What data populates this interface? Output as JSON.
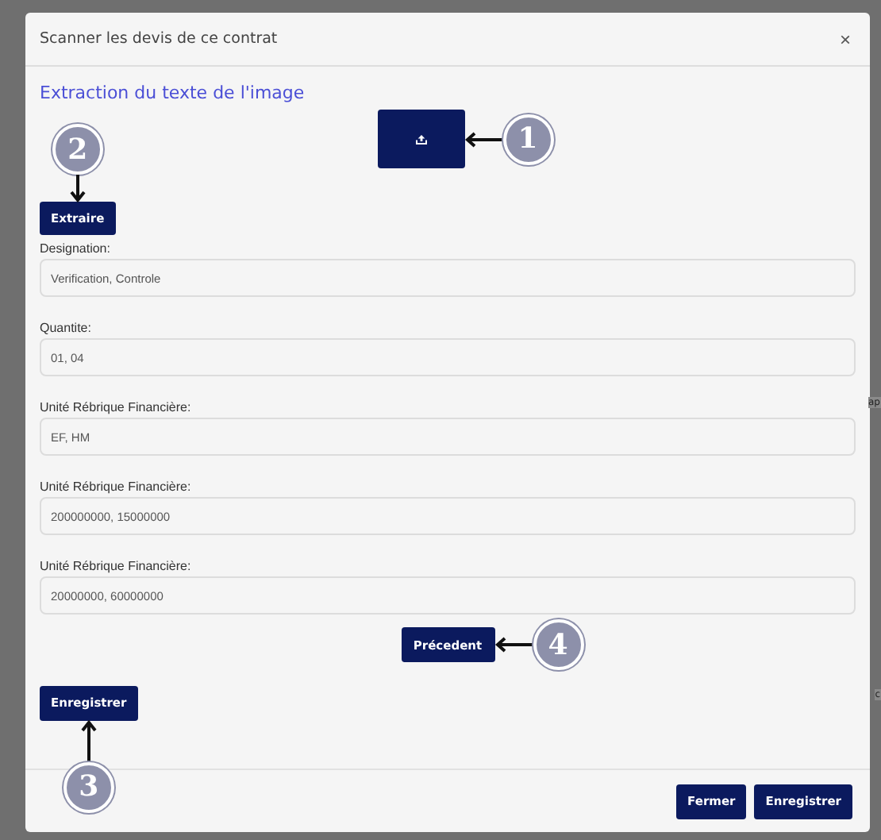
{
  "backdrop": {
    "fragments": [
      "ap",
      "c"
    ]
  },
  "modal": {
    "title": "Scanner les devis de ce contrat",
    "close": "×"
  },
  "heading": "Extraction du texte de l'image",
  "upload_button": {
    "marker": {
      "number": "1",
      "kind": "left"
    }
  },
  "extract_button": {
    "label": "Extraire",
    "marker": {
      "number": "2",
      "kind": "down"
    }
  },
  "fields": [
    {
      "label": "Designation:",
      "value": "Verification, Controle"
    },
    {
      "label": "Quantite:",
      "value": "01, 04"
    },
    {
      "label": "Unité Rébrique Financière:",
      "value": "EF, HM"
    },
    {
      "label": "Unité Rébrique Financière:",
      "value": "200000000, 15000000"
    },
    {
      "label": "Unité Rébrique Financière:",
      "value": "20000000, 60000000"
    }
  ],
  "previous_button": {
    "label": "Précedent",
    "marker": {
      "number": "4",
      "kind": "left"
    }
  },
  "save_button": {
    "label": "Enregistrer",
    "marker": {
      "number": "3",
      "kind": "up"
    }
  },
  "footer_buttons": [
    "Fermer",
    "Enregistrer"
  ]
}
